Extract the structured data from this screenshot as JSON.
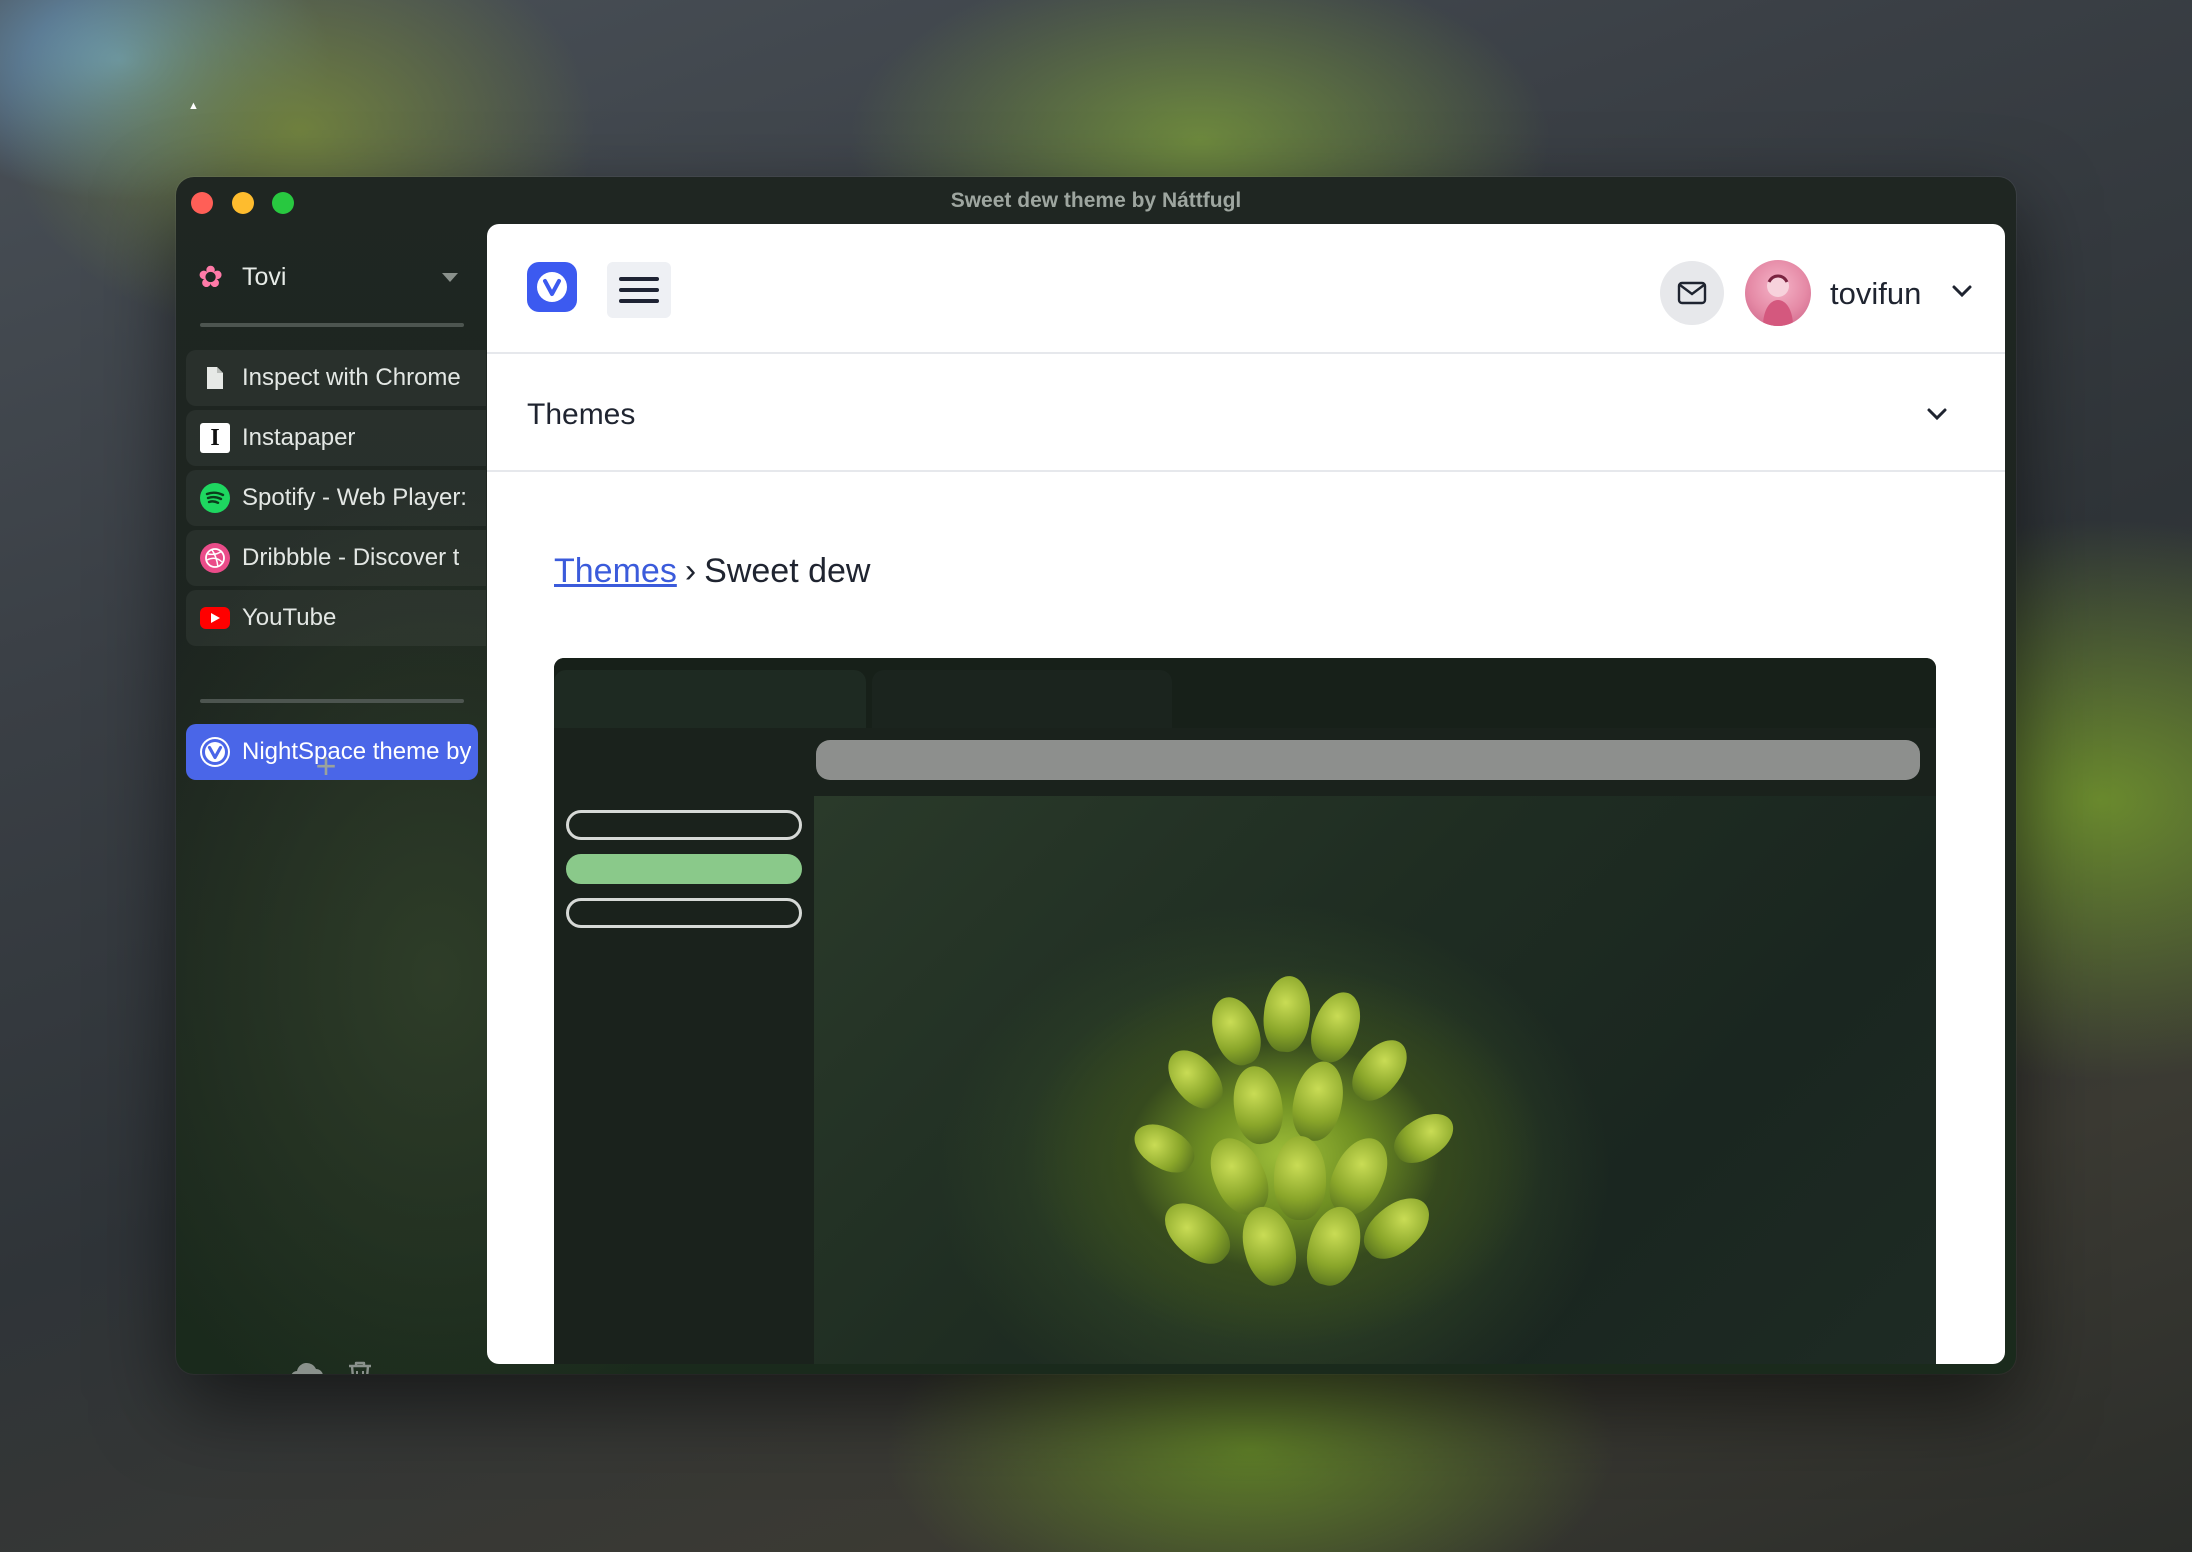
{
  "window": {
    "title": "Sweet dew theme by Náttfugl"
  },
  "sidebar": {
    "workspace": {
      "name": "Tovi",
      "icon": "flower-icon"
    },
    "pinned_tabs": [
      {
        "label": "Inspect with Chrome",
        "icon": "document-icon"
      },
      {
        "label": "Instapaper",
        "icon": "instapaper-icon"
      },
      {
        "label": "Spotify - Web Player:",
        "icon": "spotify-icon"
      },
      {
        "label": "Dribbble - Discover t",
        "icon": "dribbble-icon"
      },
      {
        "label": "YouTube",
        "icon": "youtube-icon"
      }
    ],
    "active_tab": {
      "label": "NightSpace theme by",
      "icon": "vivaldi-icon"
    },
    "add_tab": "+",
    "bottom_icons": [
      "cloud-icon",
      "trash-icon"
    ]
  },
  "page": {
    "header": {
      "username": "tovifun"
    },
    "section": {
      "title": "Themes"
    },
    "breadcrumb": {
      "link": "Themes",
      "separator": "›",
      "current": "Sweet dew"
    }
  },
  "colors": {
    "accent": "#4a66e8",
    "link": "#3b5bdb",
    "theme_highlight": "#8ac98a"
  }
}
